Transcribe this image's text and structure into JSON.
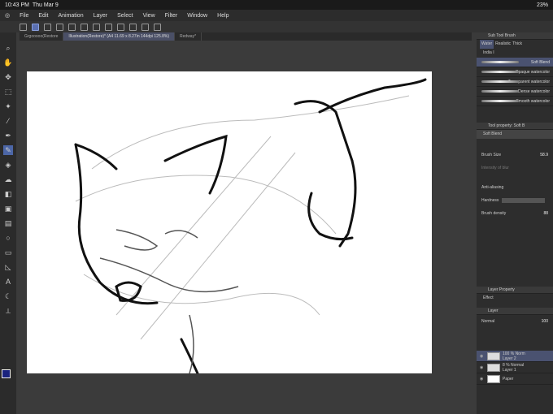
{
  "status": {
    "time": "10:43 PM",
    "date": "Thu Mar 9",
    "battery": "23%"
  },
  "menu": [
    "File",
    "Edit",
    "Animation",
    "Layer",
    "Select",
    "View",
    "Filter",
    "Window",
    "Help"
  ],
  "tabs": [
    {
      "label": "Grgooooo(Restore",
      "active": false
    },
    {
      "label": "Illustration(Restore)* (A4 11.69 x 8.27in 144dpi 125.8%)",
      "active": true
    },
    {
      "label": "Redway*",
      "active": false
    }
  ],
  "subtool": {
    "title": "Sub Tool Brush",
    "tabs": [
      "Water",
      "Realistic",
      "Thick"
    ],
    "group": "India I",
    "brushes": [
      "Soft Blend",
      "Opaque watercolor",
      "Transparent watercolor",
      "Dense watercolor",
      "Smooth watercolor"
    ]
  },
  "toolprop": {
    "title": "Tool property: Soft B",
    "name": "Soft Blend",
    "brush_size_label": "Brush Size",
    "brush_size": "58.9",
    "blur_label": "Intensity of blur",
    "antialias_label": "Anti-aliasing",
    "hardness_label": "Hardness",
    "density_label": "Brush density",
    "density": "88"
  },
  "layerprop": {
    "title": "Layer Property",
    "effect": "Effect"
  },
  "layers": {
    "title": "Layer",
    "blend": "Normal",
    "opacity": "100",
    "items": [
      {
        "pct": "100 % Norm",
        "name": "Layer 2"
      },
      {
        "pct": "8 % Normal",
        "name": "Layer 1"
      },
      {
        "pct": "",
        "name": "Paper"
      }
    ]
  },
  "colors": {
    "fg": "#1a237e",
    "bg": "#770000"
  }
}
